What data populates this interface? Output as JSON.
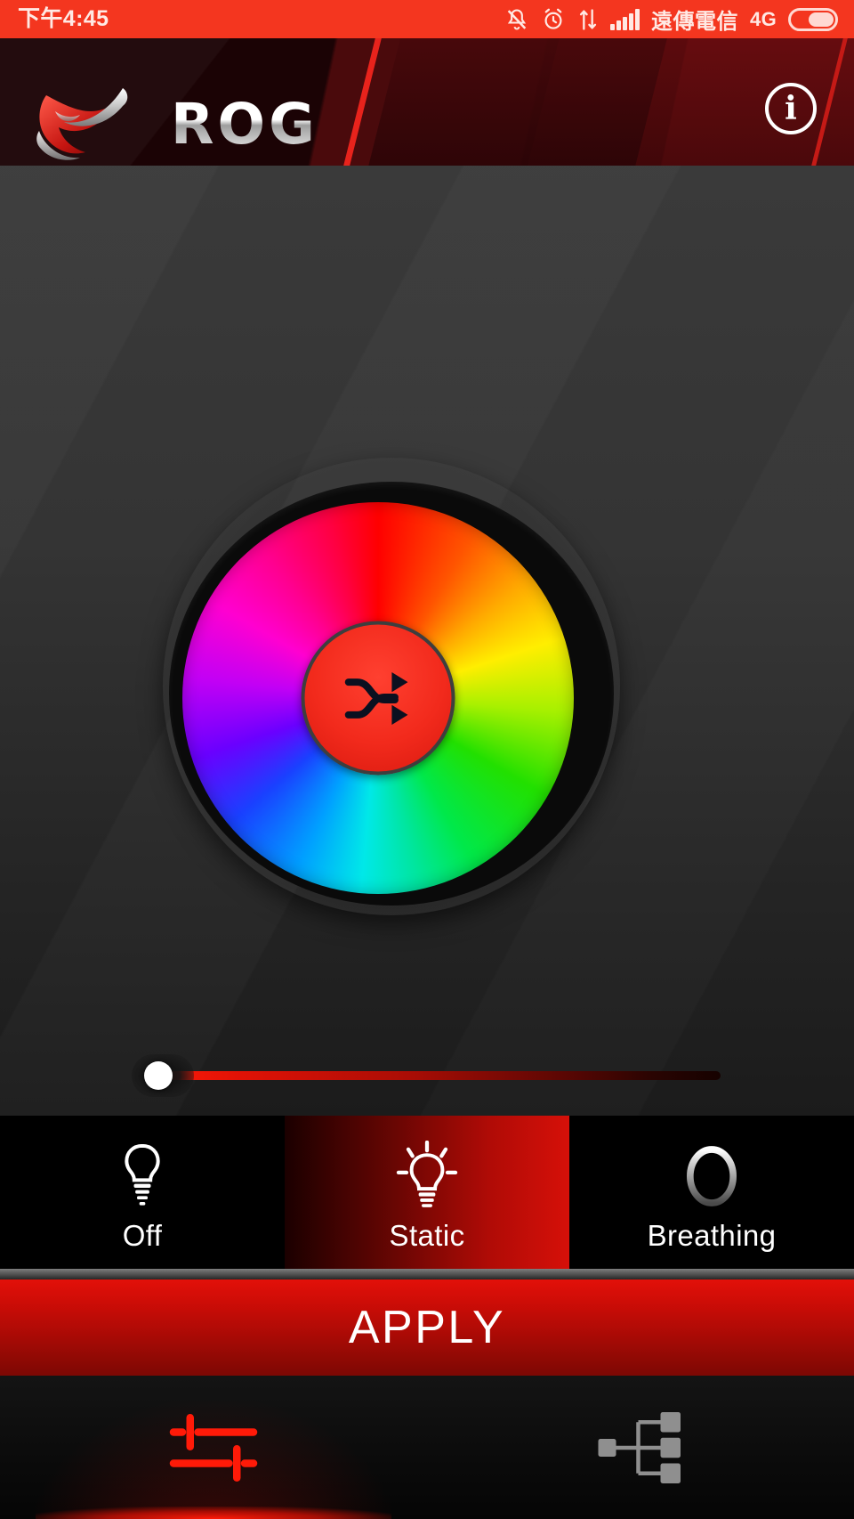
{
  "statusbar": {
    "time": "下午4:45",
    "carrier": "遠傳電信",
    "network": "4G",
    "icons": [
      "mute-icon",
      "alarm-icon",
      "data-transfer-icon",
      "signal-bars-icon",
      "battery-icon"
    ]
  },
  "header": {
    "brand": "ROG",
    "logo_icon": "rog-eye-logo-icon",
    "info_label": "i",
    "info_icon": "info-circle-icon",
    "accent_color": "#e8231c"
  },
  "main": {
    "color_wheel": {
      "name": "color-wheel",
      "center_button_icon": "shuffle-icon",
      "center_button_color": "#f22a1c",
      "hue_stops": [
        "#ff0000",
        "#ffaa00",
        "#ffee00",
        "#22e000",
        "#00e8e8",
        "#1a40ff",
        "#c200f5",
        "#ff0090"
      ]
    },
    "brightness_slider": {
      "name": "brightness-slider",
      "value": 0,
      "min": 0,
      "max": 100,
      "track_color": "#ff1a08",
      "thumb_color": "#ffffff"
    }
  },
  "modes": {
    "selected": "Static",
    "items": [
      {
        "label": "Off",
        "icon": "lightbulb-off-icon",
        "selected": false
      },
      {
        "label": "Static",
        "icon": "lightbulb-on-icon",
        "selected": true
      },
      {
        "label": "Breathing",
        "icon": "breathing-ring-icon",
        "selected": false
      }
    ]
  },
  "apply": {
    "label": "APPLY",
    "color": "#cf0d07"
  },
  "bottomnav": {
    "items": [
      {
        "icon": "lighting-settings-icon",
        "active": true,
        "color": "#ff1a08"
      },
      {
        "icon": "device-tree-icon",
        "active": false,
        "color": "#8a8a8a"
      }
    ]
  }
}
